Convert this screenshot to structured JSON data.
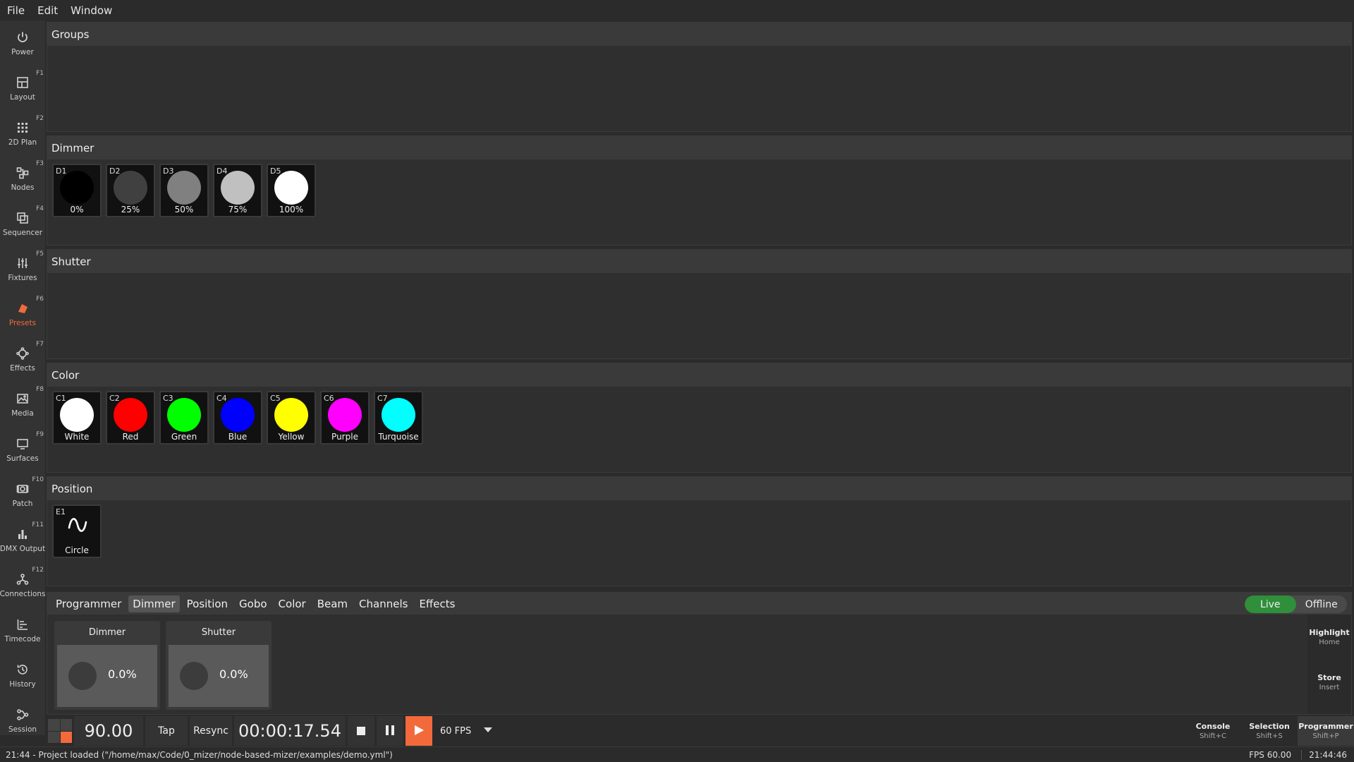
{
  "menubar": [
    "File",
    "Edit",
    "Window"
  ],
  "sidebar": [
    {
      "label": "Power",
      "key": "",
      "icon": "power-icon"
    },
    {
      "label": "Layout",
      "key": "F1",
      "icon": "layout-icon"
    },
    {
      "label": "2D Plan",
      "key": "F2",
      "icon": "grid-icon"
    },
    {
      "label": "Nodes",
      "key": "F3",
      "icon": "nodes-icon"
    },
    {
      "label": "Sequencer",
      "key": "F4",
      "icon": "sequencer-icon"
    },
    {
      "label": "Fixtures",
      "key": "F5",
      "icon": "sliders-icon"
    },
    {
      "label": "Presets",
      "key": "F6",
      "icon": "presets-icon",
      "active": true
    },
    {
      "label": "Effects",
      "key": "F7",
      "icon": "effects-icon"
    },
    {
      "label": "Media",
      "key": "F8",
      "icon": "image-icon"
    },
    {
      "label": "Surfaces",
      "key": "F9",
      "icon": "monitor-icon"
    },
    {
      "label": "Patch",
      "key": "F10",
      "icon": "patch-icon"
    },
    {
      "label": "DMX Output",
      "key": "F11",
      "icon": "bar-chart-icon"
    },
    {
      "label": "Connections",
      "key": "F12",
      "icon": "connections-icon"
    },
    {
      "label": "Timecode",
      "key": "",
      "icon": "timecode-icon"
    },
    {
      "label": "History",
      "key": "",
      "icon": "history-icon"
    },
    {
      "label": "Session",
      "key": "",
      "icon": "session-icon"
    }
  ],
  "panels": {
    "groups": {
      "title": "Groups"
    },
    "dimmer": {
      "title": "Dimmer",
      "tiles": [
        {
          "id": "D1",
          "label": "0%",
          "color": "#000000"
        },
        {
          "id": "D2",
          "label": "25%",
          "color": "#404040"
        },
        {
          "id": "D3",
          "label": "50%",
          "color": "#808080"
        },
        {
          "id": "D4",
          "label": "75%",
          "color": "#c0c0c0"
        },
        {
          "id": "D5",
          "label": "100%",
          "color": "#ffffff"
        }
      ]
    },
    "shutter": {
      "title": "Shutter"
    },
    "color": {
      "title": "Color",
      "tiles": [
        {
          "id": "C1",
          "label": "White",
          "color": "#ffffff"
        },
        {
          "id": "C2",
          "label": "Red",
          "color": "#ff0000"
        },
        {
          "id": "C3",
          "label": "Green",
          "color": "#00ff00"
        },
        {
          "id": "C4",
          "label": "Blue",
          "color": "#0000ff"
        },
        {
          "id": "C5",
          "label": "Yellow",
          "color": "#ffff00"
        },
        {
          "id": "C6",
          "label": "Purple",
          "color": "#ff00ff"
        },
        {
          "id": "C7",
          "label": "Turquoise",
          "color": "#00ffff"
        }
      ]
    },
    "position": {
      "title": "Position",
      "tiles": [
        {
          "id": "E1",
          "label": "Circle",
          "icon": "sine-wave-icon"
        }
      ]
    }
  },
  "programmer": {
    "tabs": [
      "Programmer",
      "Dimmer",
      "Position",
      "Gobo",
      "Color",
      "Beam",
      "Channels",
      "Effects"
    ],
    "active_tab": "Dimmer",
    "live": "Live",
    "offline": "Offline",
    "faders": [
      {
        "label": "Dimmer",
        "value": "0.0%"
      },
      {
        "label": "Shutter",
        "value": "0.0%"
      }
    ],
    "side": [
      {
        "title": "Highlight",
        "shortcut": "Home"
      },
      {
        "title": "Store",
        "shortcut": "Insert"
      }
    ]
  },
  "transport": {
    "bpm": "90.00",
    "tap": "Tap",
    "resync": "Resync",
    "time": "00:00:17.54",
    "fps": "60 FPS",
    "views": [
      {
        "title": "Console",
        "shortcut": "Shift+C"
      },
      {
        "title": "Selection",
        "shortcut": "Shift+S"
      },
      {
        "title": "Programmer",
        "shortcut": "Shift+P",
        "active": true
      }
    ]
  },
  "status": {
    "message": "21:44 - Project loaded (\"/home/max/Code/0_mizer/node-based-mizer/examples/demo.yml\")",
    "fps": "FPS 60.00",
    "clock": "21:44:46"
  },
  "colors": {
    "accent": "#f26a3b",
    "live": "#2f8f3a"
  }
}
